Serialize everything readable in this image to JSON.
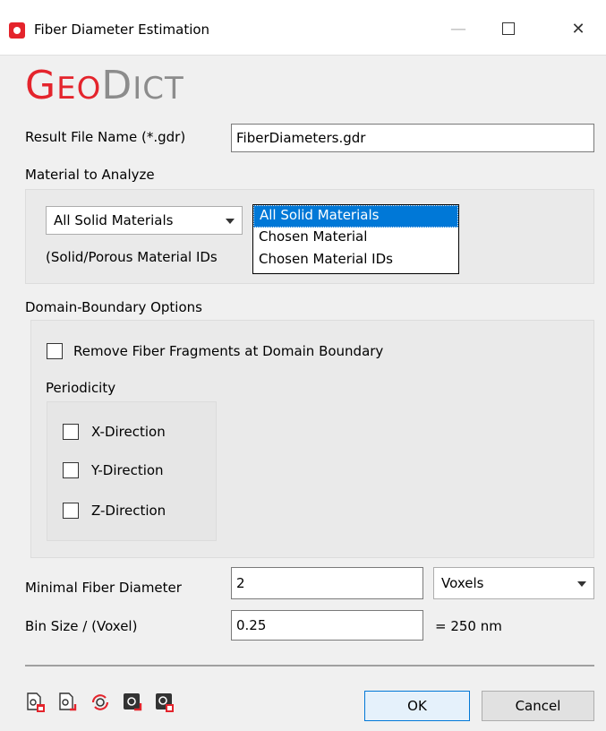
{
  "window": {
    "title": "Fiber Diameter Estimation",
    "minimize": "—",
    "close": "✕"
  },
  "logo": {
    "geo_big": "G",
    "geo_small": "EO",
    "dict_big": "D",
    "dict_small": "ICT"
  },
  "result_file": {
    "label": "Result File Name (*.gdr)",
    "value": "FiberDiameters.gdr"
  },
  "material": {
    "section_label": "Material to Analyze",
    "selected": "All Solid Materials",
    "note": "(Solid/Porous Material IDs",
    "options": [
      "All Solid Materials",
      "Chosen Material",
      "Chosen Material IDs"
    ]
  },
  "domain": {
    "section_label": "Domain-Boundary Options",
    "remove_fragments": {
      "label": "Remove Fiber Fragments at Domain Boundary",
      "checked": false
    },
    "periodicity_label": "Periodicity",
    "directions": [
      {
        "label": "X-Direction",
        "checked": false
      },
      {
        "label": "Y-Direction",
        "checked": false
      },
      {
        "label": "Z-Direction",
        "checked": false
      }
    ]
  },
  "min_diameter": {
    "label": "Minimal Fiber Diameter",
    "value": "2",
    "unit": "Voxels"
  },
  "bin_size": {
    "label": "Bin Size / (Voxel)",
    "value": "0.25",
    "converted": "= 250 nm"
  },
  "buttons": {
    "ok": "OK",
    "cancel": "Cancel"
  },
  "toolbar_icons": [
    "save-settings-icon",
    "load-settings-icon",
    "reset-settings-icon",
    "macro-icon",
    "help-settings-icon"
  ],
  "colors": {
    "brand_red": "#e4242c",
    "brand_gray": "#8c8c8c",
    "selection_blue": "#0078d7"
  }
}
